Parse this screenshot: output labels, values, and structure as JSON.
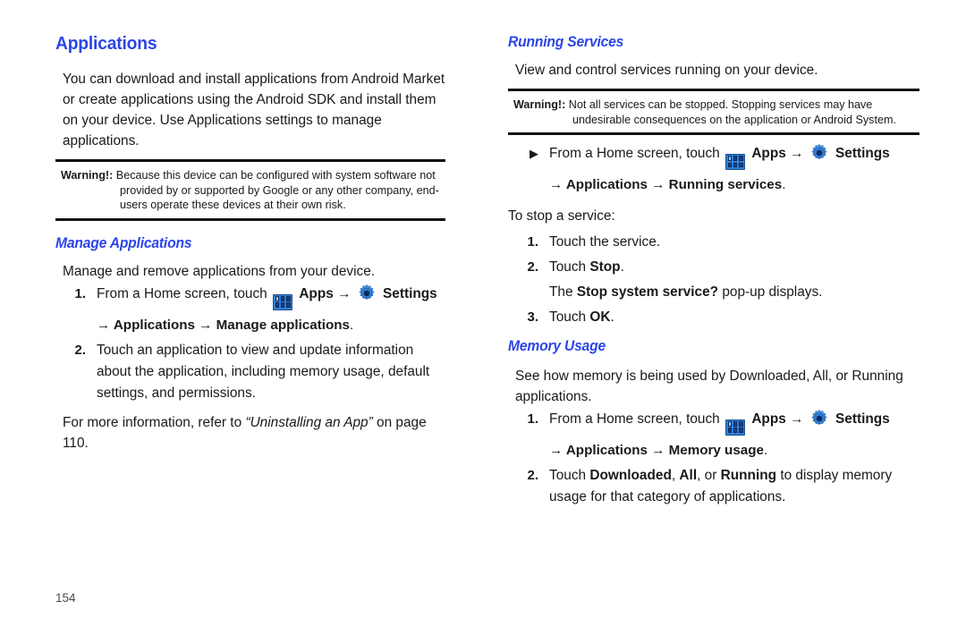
{
  "document": {
    "page_number": "154",
    "accent_color": "#2b45e8",
    "rule_color": "#111111",
    "icons": {
      "apps": "apps-grid-icon",
      "settings": "settings-gear-icon",
      "bullet": "filled-triangle-bullet",
      "arrow": "→"
    }
  },
  "left_column": {
    "section_title": "Applications",
    "intro": "You can download and install applications from Android Market or create applications using the Android SDK and install them on your device. Use Applications settings to manage applications.",
    "warning": {
      "label": "Warning!:",
      "text": "Because this device can be configured with system software not provided by or supported by Google or any other company, end-users operate these devices at their own risk."
    },
    "subsection": {
      "title": "Manage Applications",
      "intro": "Manage and remove applications from your device.",
      "steps": [
        {
          "number": "1.",
          "text_before_apps": "From a Home screen, touch",
          "apps_label": "Apps",
          "arrow": "→",
          "settings_label": "Settings",
          "nav_path": "→ Applications → Manage applications",
          "nav_path_period": "."
        },
        {
          "number": "2.",
          "text": "Touch an application to view and update information about the application, including memory usage, default settings, and permissions."
        }
      ],
      "footer_before": "For more information, refer to",
      "footer_ref": "“Uninstalling an App”",
      "footer_after": "on page 110."
    }
  },
  "right_column": {
    "running_services": {
      "title": "Running Services",
      "intro": "View and control services running on your device.",
      "warning": {
        "label": "Warning!:",
        "text": "Not all services can be stopped. Stopping services may have undesirable consequences on the application or Android System."
      },
      "bullet_step": {
        "marker": "▶",
        "text_before_apps": "From a Home screen, touch",
        "apps_label": "Apps",
        "arrow": "→",
        "settings_label": "Settings",
        "nav_path": "→ Applications → Running services",
        "nav_path_period": "."
      },
      "stop_lead_in": "To stop a service:",
      "steps": [
        {
          "number": "1.",
          "text": "Touch the service."
        },
        {
          "number": "2.",
          "text_before": "Touch",
          "bold": "Stop",
          "text_after": "."
        },
        {
          "number": "3.",
          "text_before": "Touch",
          "bold": "OK",
          "text_after": "."
        }
      ],
      "popup_note": {
        "before": "The",
        "bold": "Stop system service?",
        "after": "pop-up displays."
      }
    },
    "memory_usage": {
      "title": "Memory Usage",
      "intro": "See how memory is being used by Downloaded, All, or Running applications.",
      "steps": [
        {
          "number": "1.",
          "text_before_apps": "From a Home screen, touch",
          "apps_label": "Apps",
          "arrow": "→",
          "settings_label": "Settings",
          "nav_path": "→ Applications → Memory usage",
          "nav_path_period": "."
        },
        {
          "number": "2.",
          "text_before": "Touch",
          "bold_1": "Downloaded",
          "sep_1": ",",
          "bold_2": "All",
          "sep_2": ", or",
          "bold_3": "Running",
          "text_after": "to display memory usage for that category of applications."
        }
      ]
    }
  }
}
